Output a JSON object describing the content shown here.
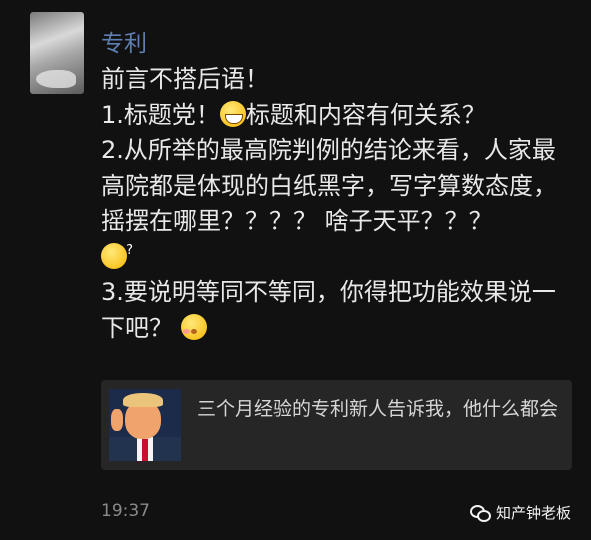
{
  "contact": {
    "name": "专利"
  },
  "message": {
    "lines": [
      "前言不搭后语！",
      "1.标题党！",
      "标题和内容有何关系？",
      "2.从所举的最高院判例的结论来看，人家最高院都是体现的白纸黑字，写字算数态度，摇摆在哪里？？？？ 啥子天平？？？",
      "3.要说明等同不等同，你得把功能效果说一下吧？"
    ],
    "emojis": [
      "grinning-emoji",
      "dizzy-face-emoji",
      "kissing-emoji"
    ]
  },
  "quote": {
    "text": "三个月经验的专利新人告诉我，他什么都会"
  },
  "time": "19:37",
  "watermark": "知产钟老板"
}
